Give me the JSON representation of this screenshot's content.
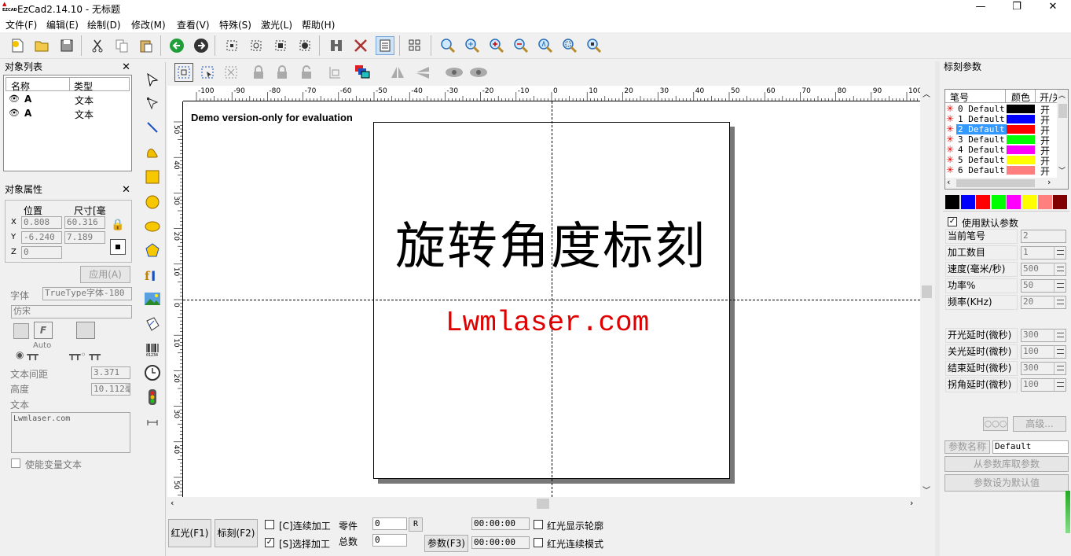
{
  "window": {
    "title": "EzCad2.14.10 - 无标题",
    "app_icon": "ezcad-icon",
    "controls": [
      "minimize-icon",
      "maximize-icon",
      "close-icon"
    ]
  },
  "menu": [
    "文件(F)",
    "编辑(E)",
    "绘制(D)",
    "修改(M)",
    "查看(V)",
    "特殊(S)",
    "激光(L)",
    "帮助(H)"
  ],
  "toolbar_icons": [
    "new-file-icon",
    "open-folder-icon",
    "save-icon",
    "cut-icon",
    "copy-icon",
    "paste-icon",
    "undo-icon",
    "redo-icon",
    "select-nodes-icon",
    "group-icon",
    "ungroup-icon",
    "node-edit-icon",
    "hatch-icon",
    "tools-icon",
    "parameter-list-icon",
    "array-icon",
    "zoom-icon",
    "zoom-in-icon",
    "zoom-plus-icon",
    "zoom-minus-icon",
    "zoom-all-icon",
    "zoom-fit-icon",
    "zoom-selection-icon"
  ],
  "object_list": {
    "title": "对象列表",
    "columns": [
      "名称",
      "类型"
    ],
    "rows": [
      {
        "name": "A",
        "type": "文本"
      },
      {
        "name": "A",
        "type": "文本"
      }
    ]
  },
  "object_props": {
    "title": "对象属性",
    "pos_label": "位置",
    "size_label": "尺寸[毫",
    "x_label": "X",
    "y_label": "Y",
    "z_label": "Z",
    "x_pos": "0.808",
    "x_size": "60.316",
    "y_pos": "-6.240",
    "y_size": "7.189",
    "z_pos": "0",
    "apply": "应用(A)"
  },
  "text_props": {
    "font_label": "字体",
    "font_type": "TrueType字体-180",
    "font_name": "仿宋",
    "auto_label": "Auto",
    "spacing_label": "文本间距",
    "spacing": "3.371",
    "height_label": "高度",
    "height": "10.112毫",
    "text_label": "文本",
    "text_value": "Lwmlaser.com",
    "var_text": "使能变量文本"
  },
  "canvas": {
    "demo_notice": "Demo version-only for evaluation",
    "text_cn": "旋转角度标刻",
    "text_en": "Lwmlaser.com",
    "ruler_h": [
      "-100",
      "-90",
      "-80",
      "-70",
      "-60",
      "-50",
      "-40",
      "-30",
      "-20",
      "-10",
      "0",
      "10",
      "20",
      "30",
      "40",
      "50",
      "60",
      "70",
      "80",
      "90",
      "100"
    ],
    "ruler_v": [
      "50",
      "40",
      "30",
      "20",
      "10",
      "0",
      "10",
      "20",
      "30",
      "40",
      "50"
    ]
  },
  "bottom": {
    "red_light": "红光(F1)",
    "mark": "标刻(F2)",
    "continuous": "[C]连续加工",
    "select_proc": "[S]选择加工",
    "parts_label": "零件",
    "total_label": "总数",
    "parts_value": "0",
    "total_value": "0",
    "reset": "R",
    "time1": "00:00:00",
    "time2": "00:00:00",
    "params": "参数(F3)",
    "show_outline": "红光显示轮廓",
    "red_continuous": "红光连续模式"
  },
  "mark_params": {
    "title": "标刻参数",
    "columns": [
      "笔号",
      "颜色",
      "开/关"
    ],
    "pens": [
      {
        "label": "0 Default",
        "color": "#000000",
        "state": "开"
      },
      {
        "label": "1 Default",
        "color": "#0000ff",
        "state": "开"
      },
      {
        "label": "2 Default",
        "color": "#ff0000",
        "state": "开"
      },
      {
        "label": "3 Default",
        "color": "#00ff00",
        "state": "开"
      },
      {
        "label": "4 Default",
        "color": "#ff00ff",
        "state": "开"
      },
      {
        "label": "5 Default",
        "color": "#ffff00",
        "state": "开"
      },
      {
        "label": "6 Default",
        "color": "#ff7f7f",
        "state": "开"
      }
    ],
    "palette": [
      "#000000",
      "#0000ff",
      "#ff0000",
      "#00ff00",
      "#ff00ff",
      "#ffff00",
      "#ff7f7f",
      "#800000"
    ],
    "use_default": "使用默认参数",
    "rows": [
      {
        "label": "当前笔号",
        "value": "2"
      },
      {
        "label": "加工数目",
        "value": "1"
      },
      {
        "label": "速度(毫米/秒)",
        "value": "500"
      },
      {
        "label": "功率%",
        "value": "50"
      },
      {
        "label": "频率(KHz)",
        "value": "20"
      }
    ],
    "delays": [
      {
        "label": "开光延时(微秒)",
        "value": "300"
      },
      {
        "label": "关光延时(微秒)",
        "value": "100"
      },
      {
        "label": "结束延时(微秒)",
        "value": "300"
      },
      {
        "label": "拐角延时(微秒)",
        "value": "100"
      }
    ],
    "advanced": "高级...",
    "param_name_label": "参数名称",
    "param_name": "Default",
    "from_lib": "从参数库取参数",
    "set_default": "参数设为默认值"
  }
}
